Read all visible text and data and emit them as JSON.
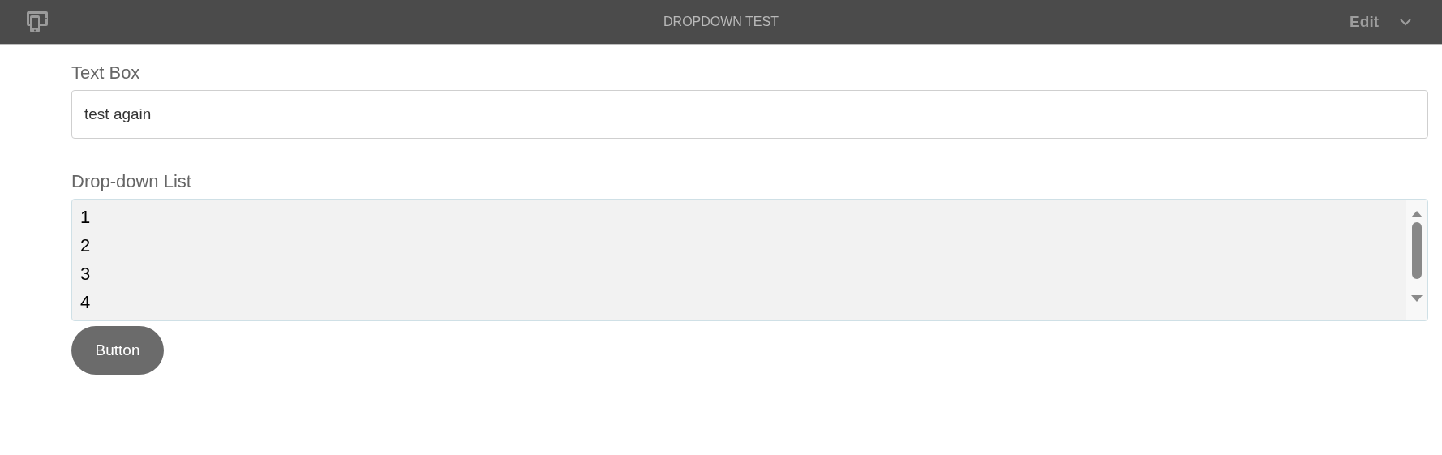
{
  "header": {
    "title": "DROPDOWN TEST",
    "menu_label": "Edit"
  },
  "text_box": {
    "label": "Text Box",
    "value": "test again"
  },
  "dropdown_list": {
    "label": "Drop-down List",
    "items": [
      "1",
      "2",
      "3",
      "4"
    ]
  },
  "button": {
    "label": "Button"
  }
}
